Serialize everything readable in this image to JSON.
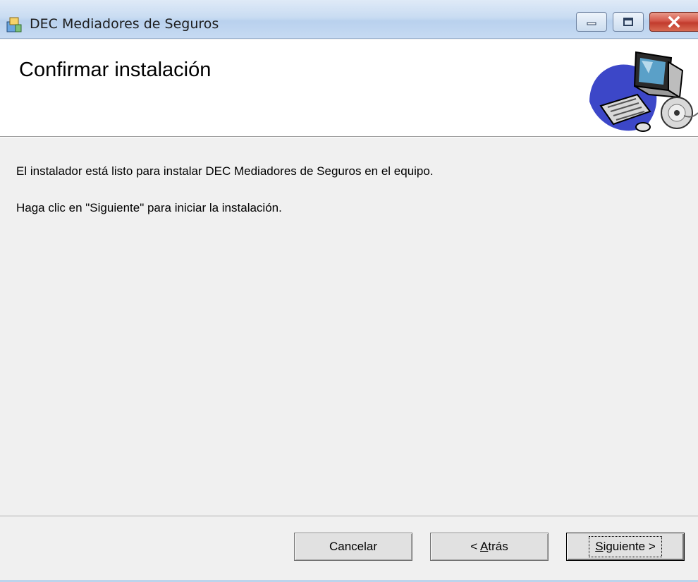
{
  "window": {
    "title": "DEC Mediadores de Seguros"
  },
  "header": {
    "title": "Confirmar instalación"
  },
  "body": {
    "line1": "El instalador está listo para instalar DEC Mediadores de Seguros en el equipo.",
    "line2": "Haga clic en \"Siguiente\" para iniciar la instalación."
  },
  "buttons": {
    "cancel": "Cancelar",
    "back_prefix": "< ",
    "back_mnemonic": "A",
    "back_rest": "trás",
    "next_mnemonic": "S",
    "next_rest": "iguiente >"
  },
  "icons": {
    "app": "installer-icon",
    "header": "computer-cd-icon"
  },
  "colors": {
    "titlebar": "#c9dcf2",
    "close_button": "#c23b2d",
    "window_background": "#f0f0f0"
  }
}
